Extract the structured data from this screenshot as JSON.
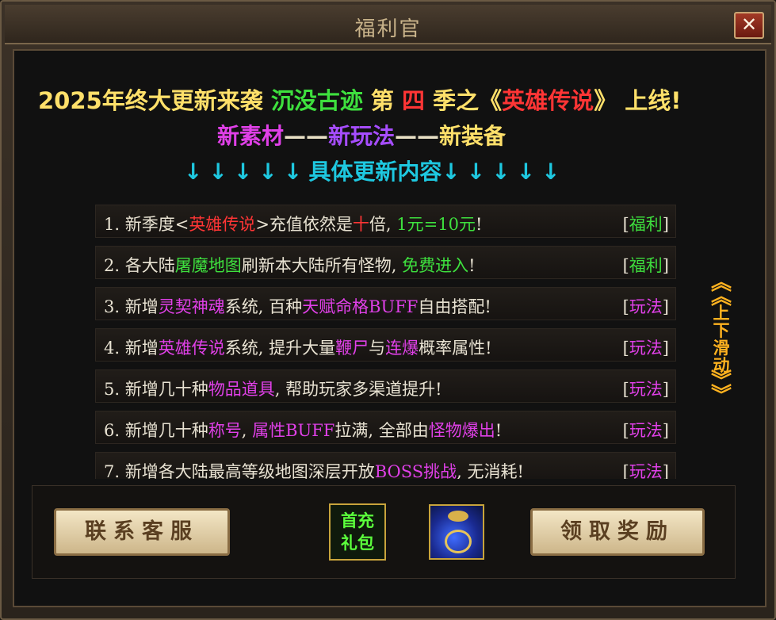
{
  "window": {
    "title": "福利官",
    "close_label": "✕"
  },
  "announcement": {
    "headline": [
      {
        "text": "2025年终大更新来袭 ",
        "color": "#ffe06a"
      },
      {
        "text": "沉没古迹",
        "color": "#3ee03e"
      },
      {
        "text": " 第 ",
        "color": "#ffe06a"
      },
      {
        "text": "四",
        "color": "#ff3535"
      },
      {
        "text": " 季之",
        "color": "#ffe06a"
      },
      {
        "text": "《",
        "color": "#ffe06a"
      },
      {
        "text": "英雄传说",
        "color": "#ff3535"
      },
      {
        "text": "》",
        "color": "#ffe06a"
      },
      {
        "text": " 上线!",
        "color": "#ffe06a"
      }
    ],
    "features": [
      "新素材",
      "新玩法",
      "新装备"
    ],
    "feature_separator": "——",
    "arrows_left": "↓↓↓↓↓",
    "details_label": "具体更新内容",
    "arrows_right": "↓↓↓↓↓"
  },
  "updates": [
    {
      "segments": [
        [
          "1. 新季度<",
          ""
        ],
        [
          "英雄传说",
          "r"
        ],
        [
          ">充值依然是",
          ""
        ],
        [
          "十",
          "r"
        ],
        [
          "倍, ",
          ""
        ],
        [
          "1元=10元",
          "g"
        ],
        [
          "!",
          ""
        ]
      ],
      "tag": "福利",
      "tag_type": "fuli"
    },
    {
      "segments": [
        [
          "2. 各大陆",
          ""
        ],
        [
          "屠魔地图",
          "g"
        ],
        [
          "刷新本大陆所有怪物, ",
          ""
        ],
        [
          "免费进入",
          "g"
        ],
        [
          "!",
          ""
        ]
      ],
      "tag": "福利",
      "tag_type": "fuli"
    },
    {
      "segments": [
        [
          "3. 新增",
          ""
        ],
        [
          "灵契神魂",
          "m"
        ],
        [
          "系统, 百种",
          ""
        ],
        [
          "天赋命格BUFF",
          "m"
        ],
        [
          "自由搭配!",
          ""
        ]
      ],
      "tag": "玩法",
      "tag_type": "wanfa"
    },
    {
      "segments": [
        [
          "4. 新增",
          ""
        ],
        [
          "英雄传说",
          "m"
        ],
        [
          "系统, 提升大量",
          ""
        ],
        [
          "鞭尸",
          "m"
        ],
        [
          "与",
          ""
        ],
        [
          "连爆",
          "m"
        ],
        [
          "概率属性!",
          ""
        ]
      ],
      "tag": "玩法",
      "tag_type": "wanfa"
    },
    {
      "segments": [
        [
          "5. 新增几十种",
          ""
        ],
        [
          "物品道具",
          "m"
        ],
        [
          ", 帮助玩家多渠道提升!",
          ""
        ]
      ],
      "tag": "玩法",
      "tag_type": "wanfa"
    },
    {
      "segments": [
        [
          "6. 新增几十种",
          ""
        ],
        [
          "称号",
          "m"
        ],
        [
          ", ",
          ""
        ],
        [
          "属性BUFF",
          "m"
        ],
        [
          "拉满, 全部由",
          ""
        ],
        [
          "怪物爆出",
          "m"
        ],
        [
          "!",
          ""
        ]
      ],
      "tag": "玩法",
      "tag_type": "wanfa"
    },
    {
      "segments": [
        [
          "7. 新增各大陆最高等级地图深层开放",
          ""
        ],
        [
          "BOSS挑战",
          "m"
        ],
        [
          ", 无消耗!",
          ""
        ]
      ],
      "tag": "玩法",
      "tag_type": "wanfa"
    }
  ],
  "scroll_hint": {
    "top_arrows": "︽",
    "text_line1": "上",
    "text_line2": "下",
    "text_line3": "滑",
    "text_line4": "动",
    "bottom_arrows": "︾"
  },
  "buttons": {
    "contact": "联系客服",
    "claim": "领取奖励"
  },
  "gift": {
    "line1": "首充",
    "line2": "礼包"
  }
}
